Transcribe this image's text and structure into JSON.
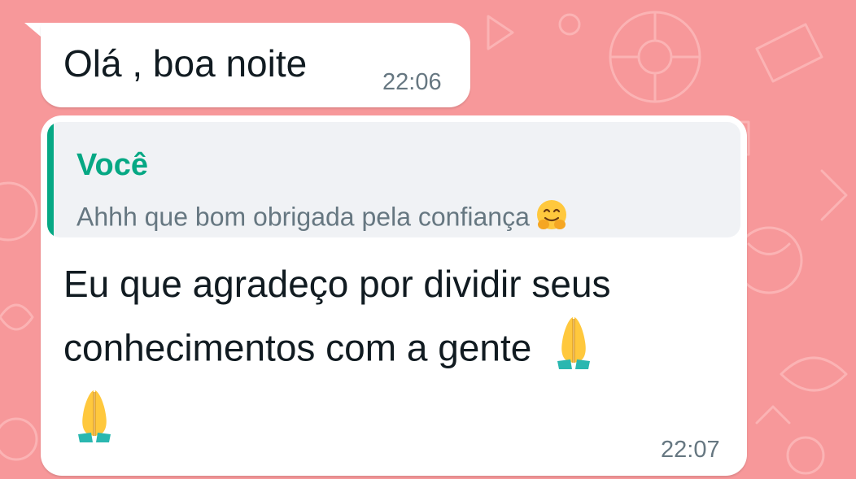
{
  "chat": {
    "messages": [
      {
        "text": "Olá , boa noite",
        "time": "22:06"
      },
      {
        "quoted": {
          "author": "Você",
          "text": "Ahhh que bom obrigada  pela confiança",
          "emoji": "hugging-face-emoji"
        },
        "line1": "Eu que agradeço por dividir seus",
        "line2": "conhecimentos com a gente",
        "emoji": "folded-hands-emoji",
        "time": "22:07"
      }
    ]
  },
  "colors": {
    "wallpaper": "#f7989a",
    "bubble": "#ffffff",
    "quote_accent": "#06a884",
    "quote_background": "#f0f2f5",
    "timestamp": "#667781",
    "message_text": "#111b21"
  }
}
